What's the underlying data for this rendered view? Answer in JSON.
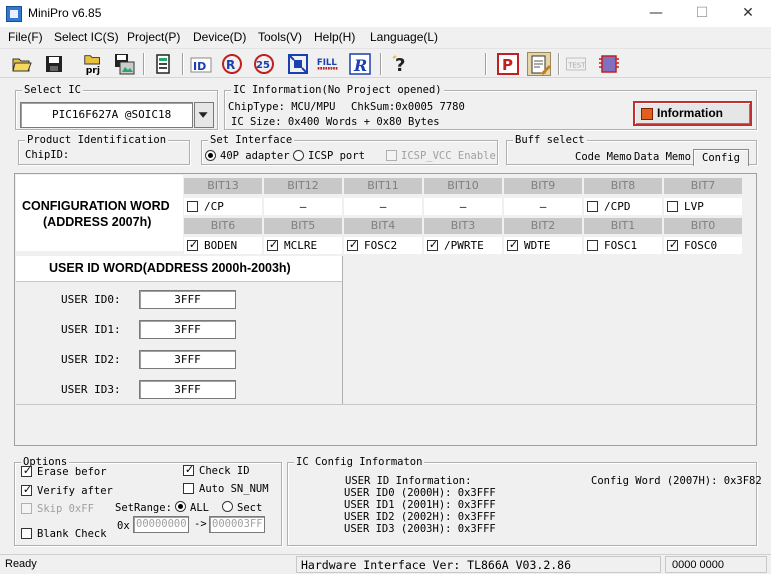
{
  "window": {
    "title": "MiniPro v6.85",
    "minimize": "—",
    "maximize": "☐",
    "close": "✕"
  },
  "menu": [
    "File(F)",
    "Select IC(S)",
    "Project(P)",
    "Device(D)",
    "Tools(V)",
    "Help(H)",
    "Language(L)"
  ],
  "toolbar": {
    "id_label": "ID",
    "fill_label": "FILL",
    "r_label": "R",
    "p_label": "P",
    "test_label": "TEST"
  },
  "select_ic": {
    "title": "Select IC",
    "value": "PIC16F627A @SOIC18"
  },
  "ic_info": {
    "title": "IC Information(No Project opened)",
    "chip_type": "ChipType:  MCU/MPU",
    "chksum": "ChkSum:0x0005 7780",
    "ic_size": "IC Size:   0x400 Words + 0x80 Bytes",
    "button": "Information"
  },
  "product_id": {
    "title": "Product Identification",
    "chip_id": "ChipID:"
  },
  "interface": {
    "title": "Set Interface",
    "opt1": "40P adapter",
    "opt2": "ICSP port",
    "icsp_vcc": "ICSP_VCC Enable"
  },
  "buff_select": {
    "title": "Buff select",
    "tabs": [
      "Code Memo",
      "Data Memo",
      "Config"
    ]
  },
  "config": {
    "heading_line1": "CONFIGURATION WORD",
    "heading_line2": "(ADDRESS 2007h)",
    "bits_high": [
      {
        "head": "BIT13",
        "name": "/CP",
        "checked": false,
        "active": true
      },
      {
        "head": "BIT12",
        "name": "–",
        "checked": false,
        "active": false
      },
      {
        "head": "BIT11",
        "name": "–",
        "checked": false,
        "active": false
      },
      {
        "head": "BIT10",
        "name": "–",
        "checked": false,
        "active": false
      },
      {
        "head": "BIT9",
        "name": "–",
        "checked": false,
        "active": false
      },
      {
        "head": "BIT8",
        "name": "/CPD",
        "checked": false,
        "active": true
      },
      {
        "head": "BIT7",
        "name": "LVP",
        "checked": false,
        "active": true
      }
    ],
    "bits_low": [
      {
        "head": "BIT6",
        "name": "BODEN",
        "checked": true,
        "active": true
      },
      {
        "head": "BIT5",
        "name": "MCLRE",
        "checked": true,
        "active": true
      },
      {
        "head": "BIT4",
        "name": "FOSC2",
        "checked": true,
        "active": true
      },
      {
        "head": "BIT3",
        "name": "/PWRTE",
        "checked": true,
        "active": true
      },
      {
        "head": "BIT2",
        "name": "WDTE",
        "checked": true,
        "active": true
      },
      {
        "head": "BIT1",
        "name": "FOSC1",
        "checked": false,
        "active": true
      },
      {
        "head": "BIT0",
        "name": "FOSC0",
        "checked": true,
        "active": true
      }
    ],
    "user_id_heading": "USER ID WORD(ADDRESS 2000h-2003h)",
    "user_ids": [
      {
        "label": "USER ID0:",
        "value": "3FFF"
      },
      {
        "label": "USER ID1:",
        "value": "3FFF"
      },
      {
        "label": "USER ID2:",
        "value": "3FFF"
      },
      {
        "label": "USER ID3:",
        "value": "3FFF"
      }
    ]
  },
  "options": {
    "title": "Options",
    "erase": "Erase befor",
    "verify": "Verify after",
    "skip": "Skip 0xFF",
    "blank": "Blank Check",
    "check_id": "Check ID",
    "auto_sn": "Auto SN_NUM",
    "setrange": "SetRange:",
    "all": "ALL",
    "sect": "Sect",
    "ox": "0x",
    "range_from": "00000000",
    "arrow": "->",
    "range_to": "000003FF"
  },
  "ic_config": {
    "title": "IC Config Informaton",
    "user_id_info": "USER ID Information:",
    "lines": [
      "USER ID0 (2000H): 0x3FFF",
      "USER ID1 (2001H): 0x3FFF",
      "USER ID2 (2002H): 0x3FFF",
      "USER ID3 (2003H): 0x3FFF"
    ],
    "config_word": "Config Word (2007H): 0x3F82"
  },
  "status": {
    "ready": "Ready",
    "hw": "Hardware Interface Ver: TL866A V03.2.86",
    "code": "0000 0000"
  }
}
